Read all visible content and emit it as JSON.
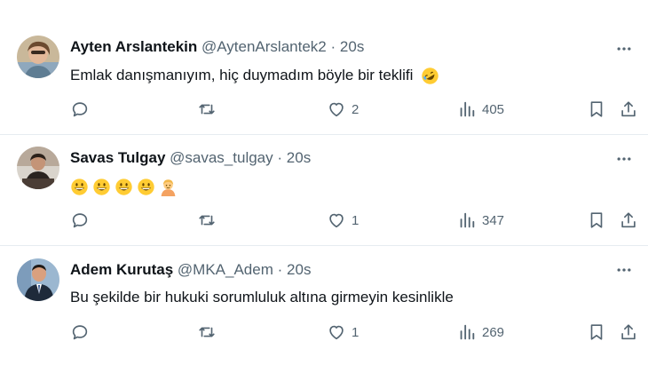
{
  "tweets": [
    {
      "name": "Ayten Arslantekin",
      "handle": "@AytenArslantek2",
      "separator": "·",
      "time": "20s",
      "text": "Emlak danışmanıyım, hiç duymadım böyle bir teklifi",
      "emoji": [
        "rolling-on-floor-laughing"
      ],
      "likes": "2",
      "views": "405"
    },
    {
      "name": "Savas Tulgay",
      "handle": "@savas_tulgay",
      "separator": "·",
      "time": "20s",
      "text": "",
      "emoji": [
        "grinning-face",
        "grinning-face",
        "grinning-face",
        "grinning-face",
        "person-gesturing"
      ],
      "likes": "1",
      "views": "347"
    },
    {
      "name": "Adem Kurutaş",
      "handle": "@MKA_Adem",
      "separator": "·",
      "time": "20s",
      "text": "Bu şekilde bir hukuki sorumluluk altına girmeyin kesinlikle",
      "emoji": [],
      "likes": "1",
      "views": "269"
    }
  ],
  "icons": {
    "reply": "reply-icon",
    "retweet": "retweet-icon",
    "like": "heart-icon",
    "views": "views-icon",
    "bookmark": "bookmark-icon",
    "share": "share-icon",
    "more": "more-icon"
  },
  "colors": {
    "text": "#0f1419",
    "secondary": "#536471",
    "divider": "#e6ecf0"
  }
}
